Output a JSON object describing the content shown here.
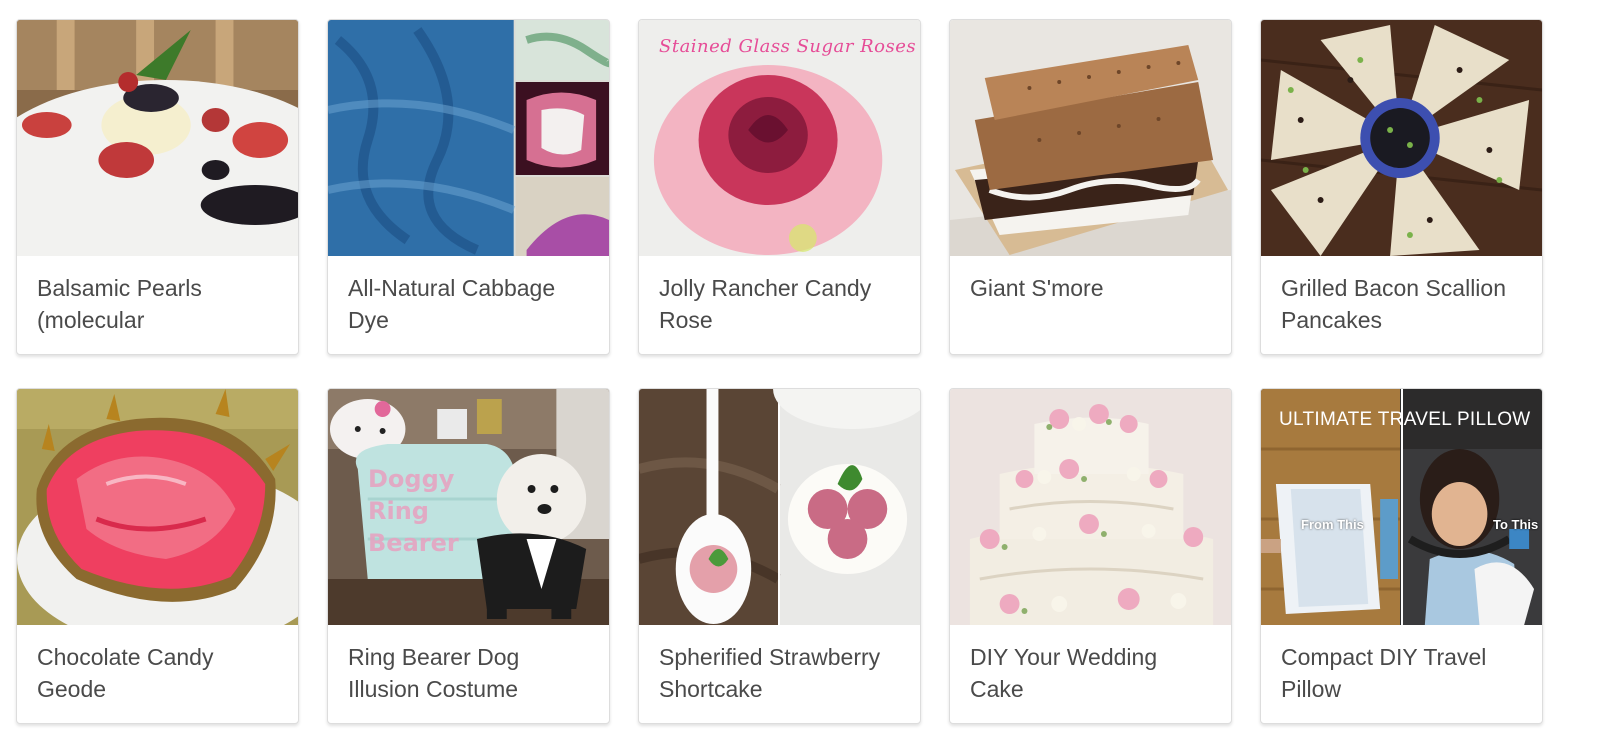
{
  "projects": [
    {
      "title": "Balsamic Pearls (molecular"
    },
    {
      "title": "All-Natural Cabbage Dye"
    },
    {
      "title": "Jolly Rancher Candy Rose",
      "image_text": "Stained Glass Sugar Roses"
    },
    {
      "title": "Giant S'more"
    },
    {
      "title": "Grilled Bacon Scallion Pancakes"
    },
    {
      "title": "Chocolate Candy Geode"
    },
    {
      "title": "Ring Bearer Dog Illusion Costume",
      "image_text": "Doggy Ring Bearer"
    },
    {
      "title": "Spherified Strawberry Shortcake"
    },
    {
      "title": "DIY Your Wedding Cake"
    },
    {
      "title": "Compact DIY Travel Pillow",
      "image_text": "ULTIMATE TRAVEL PILLOW",
      "image_text_left": "From This",
      "image_text_right": "To This"
    }
  ]
}
